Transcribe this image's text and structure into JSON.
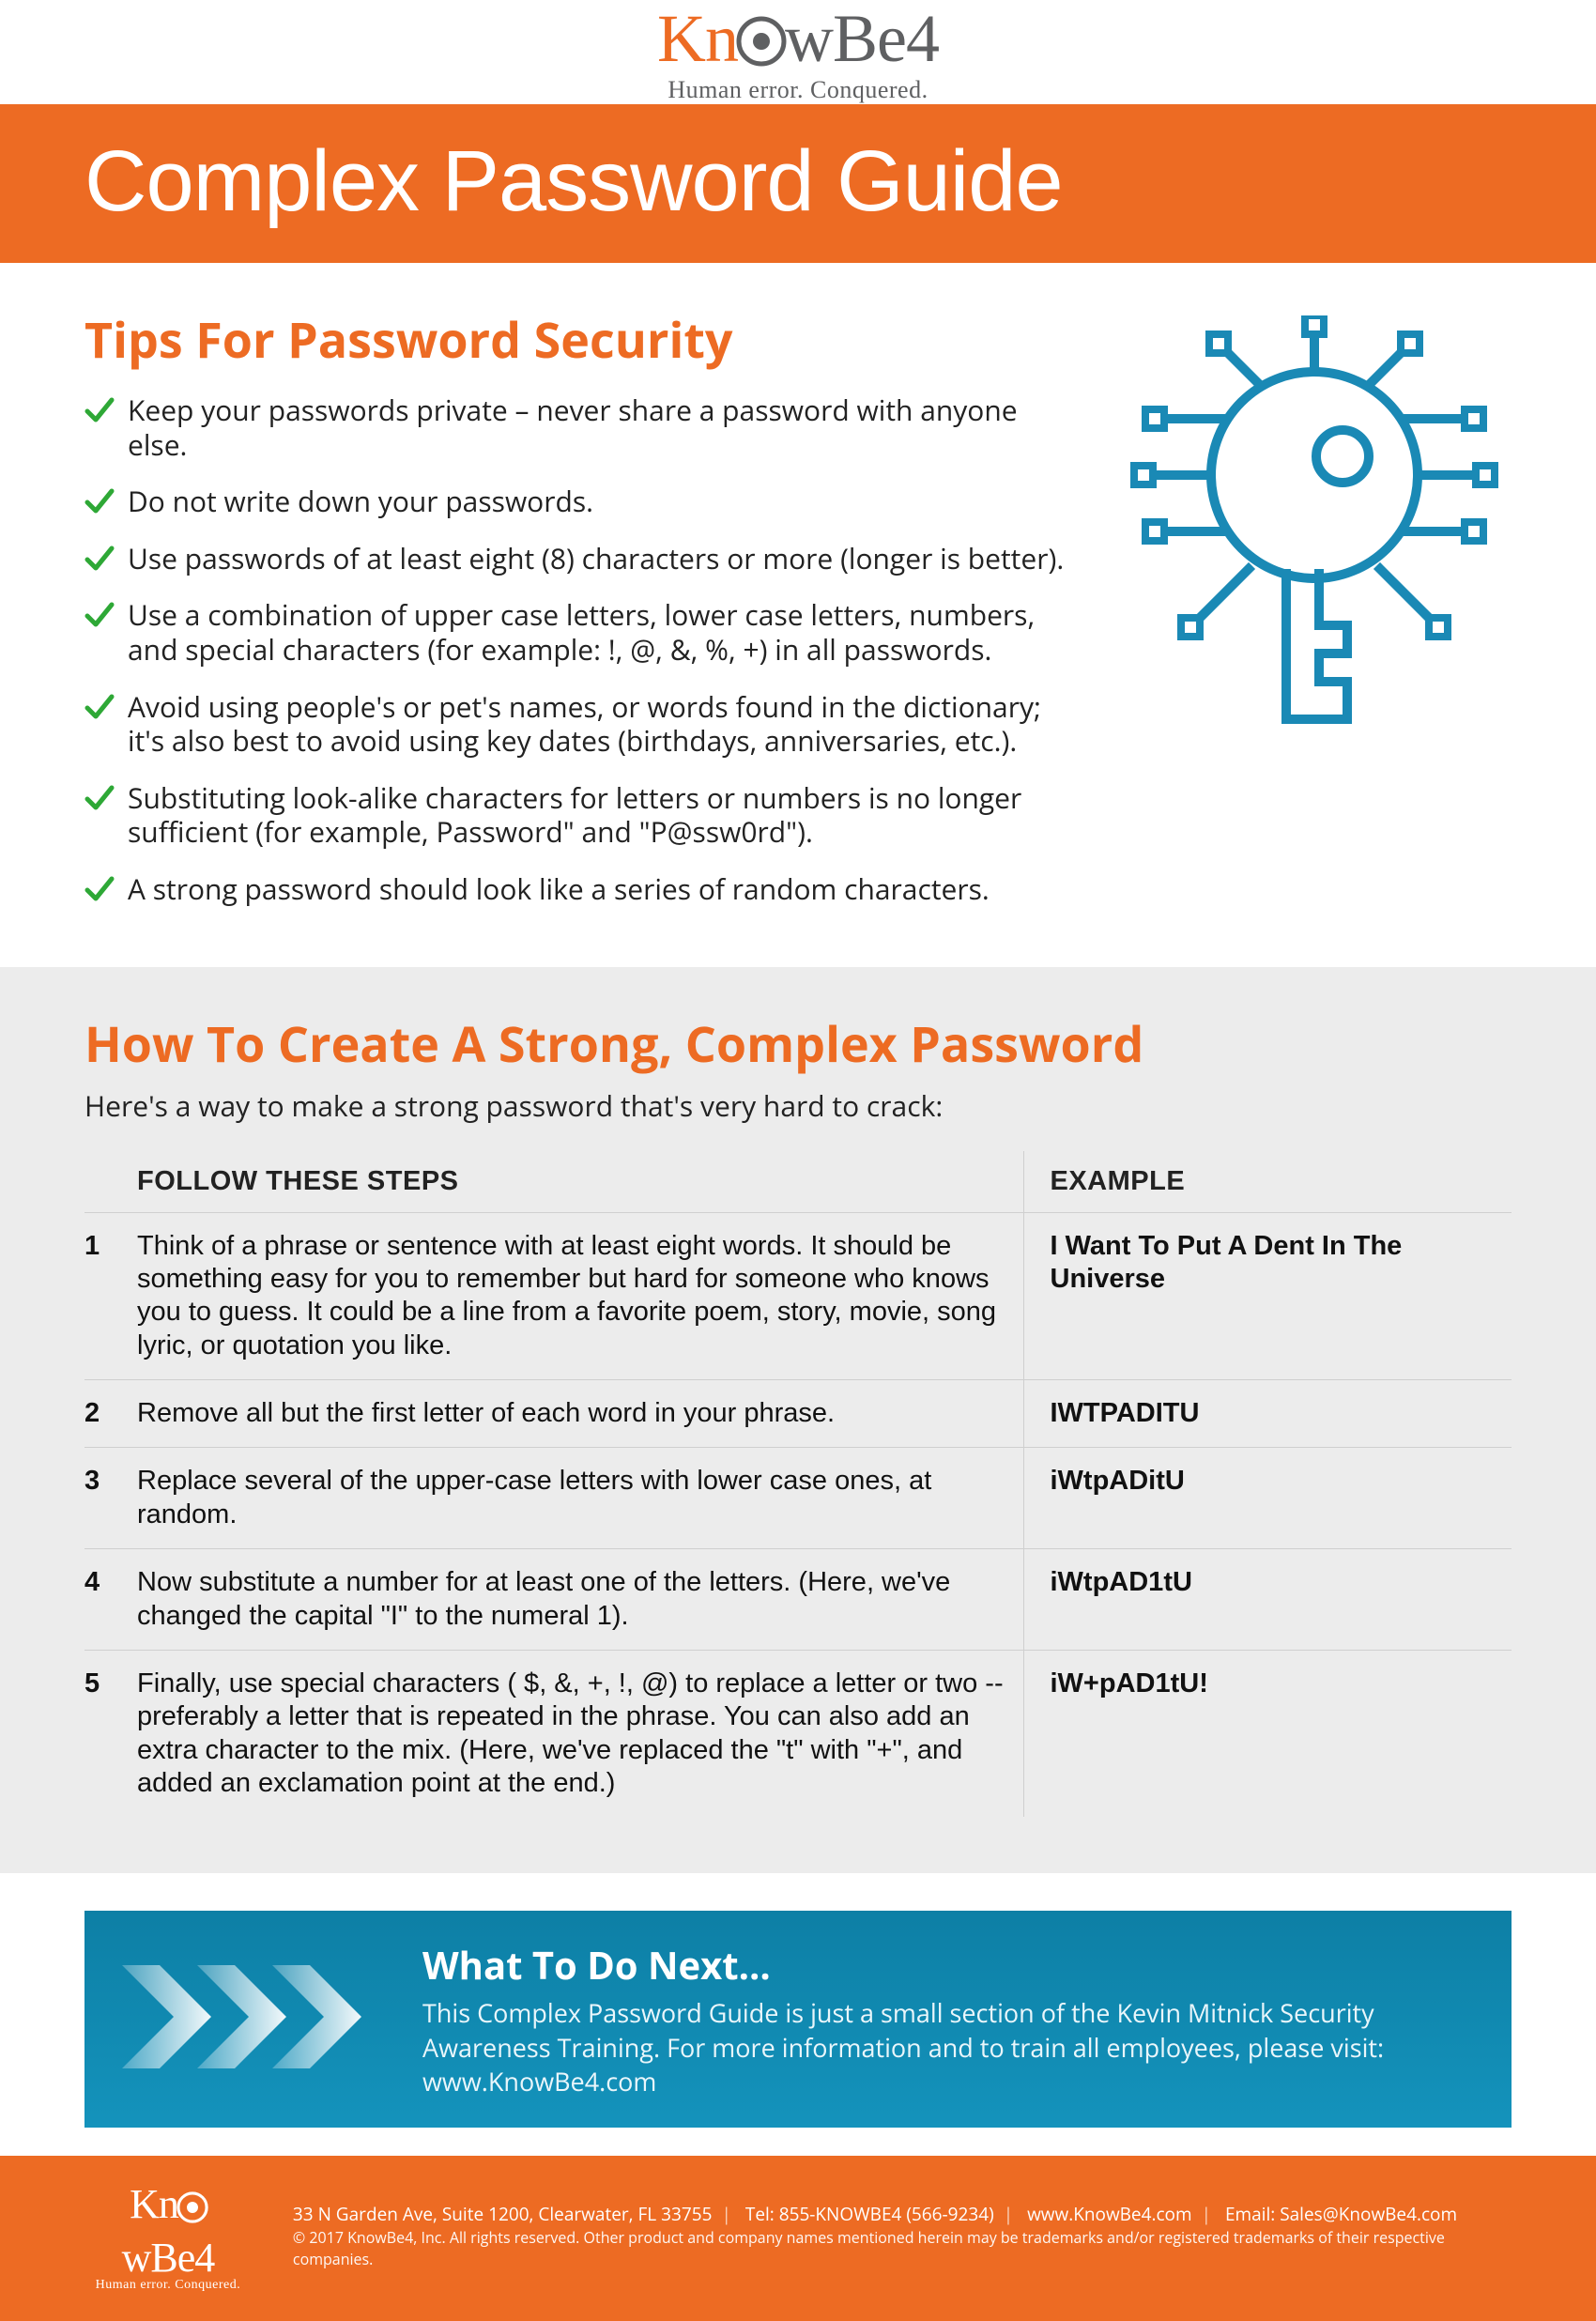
{
  "brand": {
    "name_pre": "Kn",
    "name_post": "wBe4",
    "tagline": "Human error. Conquered."
  },
  "title": "Complex Password Guide",
  "tips": {
    "heading": "Tips For Password Security",
    "items": [
      "Keep your passwords private – never share a password with anyone else.",
      "Do not write down your passwords.",
      "Use passwords of at least eight (8) characters or more (longer is better).",
      "Use a combination of upper case letters, lower case letters, numbers, and special characters (for example: !, @, &, %, +) in all passwords.",
      "Avoid using people's or pet's names, or words found in the dictionary; it's also best to avoid using key dates (birthdays, anniversaries, etc.).",
      "Substituting look-alike characters for letters or numbers is no longer sufficient (for example, Password\" and \"P@ssw0rd\").",
      "A strong password should look like a series of random characters."
    ]
  },
  "howto": {
    "heading": "How To Create A Strong, Complex Password",
    "intro": "Here's a way to make a strong password that's very hard to crack:",
    "col_steps": "FOLLOW THESE STEPS",
    "col_example": "EXAMPLE",
    "rows": [
      {
        "n": "1",
        "step": "Think of a phrase or sentence with at least eight words. It should be something easy for you to remember but hard for someone who knows you to guess. It could be a line from a favorite poem, story, movie, song lyric, or quotation you like.",
        "example": "I Want To Put A Dent In The Universe"
      },
      {
        "n": "2",
        "step": "Remove all but the first letter of each word in your phrase.",
        "example": "IWTPADITU"
      },
      {
        "n": "3",
        "step": "Replace several of the upper-case letters with lower case ones, at random.",
        "example": "iWtpADitU"
      },
      {
        "n": "4",
        "step": "Now substitute a number for at least one of the letters. (Here, we've changed the capital \"I\" to the numeral 1).",
        "example": "iWtpAD1tU"
      },
      {
        "n": "5",
        "step": "Finally, use special characters ( $, &, +, !, @) to replace a letter or two -- preferably a letter that is repeated in the phrase. You can also add an extra character to the mix. (Here, we've replaced the \"t\" with \"+\", and added an exclamation point at the end.)",
        "example": "iW+pAD1tU!"
      }
    ]
  },
  "next": {
    "heading": "What To Do Next...",
    "body": "This Complex Password Guide is just a small section of the Kevin Mitnick Security Awareness Training. For more information and to train all employees, please visit:  www.KnowBe4.com"
  },
  "footer": {
    "address": "33 N Garden Ave, Suite 1200, Clearwater, FL 33755",
    "tel": "Tel: 855-KNOWBE4 (566-9234)",
    "web": "www.KnowBe4.com",
    "email": "Email: Sales@KnowBe4.com",
    "legal": "© 2017 KnowBe4, Inc.  All rights reserved.  Other product and company names mentioned herein may be trademarks and/or registered trademarks of their respective companies."
  }
}
